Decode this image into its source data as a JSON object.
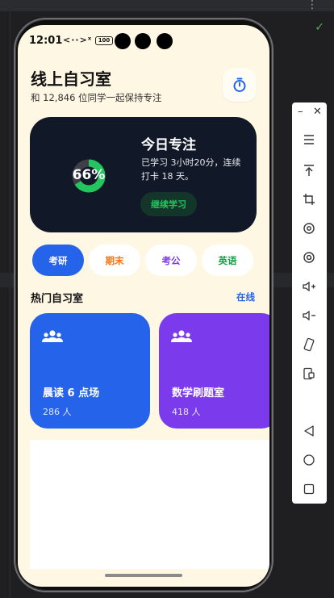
{
  "status_bar": {
    "time": "12:01",
    "signal": "<··>ˣ",
    "battery": "100"
  },
  "header": {
    "title": "线上自习室",
    "subtitle": "和 12,846 位同学一起保持专注"
  },
  "focus_card": {
    "progress_percent": 66,
    "progress_label": "66%",
    "title": "今日专注",
    "description": "已学习 3小时20分，连续打卡 18 天。",
    "button_label": "继续学习"
  },
  "categories": [
    {
      "label": "考研",
      "color": "#ffffff",
      "active": true
    },
    {
      "label": "期末",
      "color": "#f97316",
      "active": false
    },
    {
      "label": "考公",
      "color": "#7c3aed",
      "active": false
    },
    {
      "label": "英语",
      "color": "#16a34a",
      "active": false
    }
  ],
  "popular_section": {
    "title": "热门自习室",
    "link_label": "在线"
  },
  "rooms": [
    {
      "name": "晨读 6 点场",
      "count": "286 人",
      "color": "#2563eb"
    },
    {
      "name": "数学刷题室",
      "count": "418 人",
      "color": "#7c3aed"
    }
  ],
  "colors": {
    "accent_blue": "#2563eb",
    "accent_green": "#22c55e",
    "card_dark": "#111827",
    "background": "#fdf7e3"
  },
  "toolbar": {
    "items": [
      "minimize-icon",
      "close-icon",
      "menu-icon",
      "upload-top-icon",
      "crop-icon",
      "rotate-icon",
      "screenshot-icon",
      "volume-up-icon",
      "volume-down-icon",
      "rotate-device-icon",
      "fold-icon",
      "back-icon",
      "home-icon",
      "recents-icon"
    ]
  }
}
